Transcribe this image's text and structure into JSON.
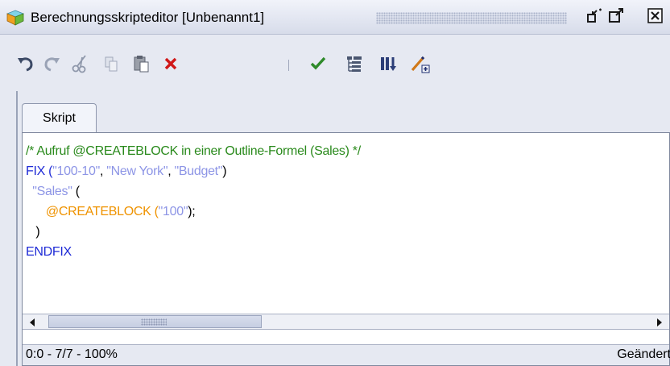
{
  "window": {
    "title": "Berechnungsskripteditor [Unbenannt1]",
    "icons": [
      "app-cube-icon",
      "minimize-restore-icon",
      "maximize-icon",
      "close-icon"
    ]
  },
  "toolbar": {
    "items": [
      "undo-icon",
      "redo-icon",
      "cut-icon",
      "copy-icon",
      "paste-icon",
      "delete-icon",
      "separator",
      "validate-icon",
      "outline-icon",
      "columns-icon",
      "insert-formula-icon"
    ]
  },
  "tabs": [
    {
      "label": "Skript",
      "active": true
    }
  ],
  "editor": {
    "lines": [
      [
        {
          "text": "/* Aufruf @CREATEBLOCK in einer Outline-Formel (Sales) */",
          "kind": "comment"
        }
      ],
      [
        {
          "text": "FIX (",
          "kind": "key"
        },
        {
          "text": "\"100-10\"",
          "kind": "str"
        },
        {
          "text": ", ",
          "kind": "plain"
        },
        {
          "text": "\"New York\"",
          "kind": "str"
        },
        {
          "text": ", ",
          "kind": "plain"
        },
        {
          "text": "\"Budget\"",
          "kind": "str"
        },
        {
          "text": ")",
          "kind": "plain"
        }
      ],
      [
        {
          "text": "  ",
          "kind": "plain"
        },
        {
          "text": "\"Sales\"",
          "kind": "str"
        },
        {
          "text": " (",
          "kind": "plain"
        }
      ],
      [
        {
          "text": "      ",
          "kind": "plain"
        },
        {
          "text": "@CREATEBLOCK (",
          "kind": "func"
        },
        {
          "text": "\"100\"",
          "kind": "str"
        },
        {
          "text": ");",
          "kind": "plain"
        }
      ],
      [
        {
          "text": "   )",
          "kind": "plain"
        }
      ],
      [
        {
          "text": "ENDFIX",
          "kind": "key"
        }
      ]
    ],
    "colors": {
      "comment": "#2a8a1c",
      "key": "#1f2bd6",
      "str": "#8d95e6",
      "func": "#ef9300",
      "plain": "#000000"
    }
  },
  "status": {
    "position": "0:0 - 7/7 - 100%",
    "state": "Geändert"
  }
}
